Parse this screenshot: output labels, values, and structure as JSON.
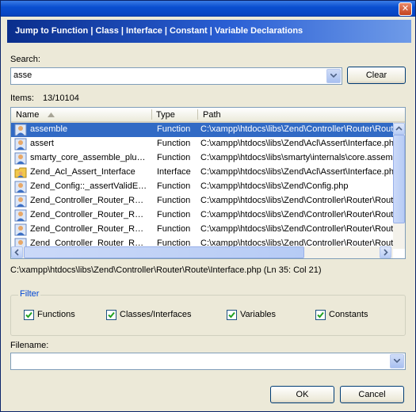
{
  "dialog": {
    "header": "Jump to Function | Class | Interface | Constant | Variable  Declarations",
    "close_glyph": "✕"
  },
  "search": {
    "label": "Search:",
    "value": "asse",
    "clear_label": "Clear"
  },
  "items": {
    "label": "Items:",
    "count": "13/10104"
  },
  "table": {
    "columns": {
      "name": "Name",
      "type": "Type",
      "path": "Path"
    },
    "rows": [
      {
        "name": "assemble",
        "type": "Function",
        "path": "C:\\xampp\\htdocs\\libs\\Zend\\Controller\\Router\\Route\\Interface.php",
        "icon": "function-icon",
        "selected": true
      },
      {
        "name": "assert",
        "type": "Function",
        "path": "C:\\xampp\\htdocs\\libs\\Zend\\Acl\\Assert\\Interface.php",
        "icon": "function-icon"
      },
      {
        "name": "smarty_core_assemble_plu…",
        "type": "Function",
        "path": "C:\\xampp\\htdocs\\libs\\smarty\\internals\\core.assemble_plugin_filepath.php",
        "icon": "function-icon"
      },
      {
        "name": "Zend_Acl_Assert_Interface",
        "type": "Interface",
        "path": "C:\\xampp\\htdocs\\libs\\Zend\\Acl\\Assert\\Interface.php",
        "icon": "interface-icon"
      },
      {
        "name": "Zend_Config::_assertValidE…",
        "type": "Function",
        "path": "C:\\xampp\\htdocs\\libs\\Zend\\Config.php",
        "icon": "function-icon"
      },
      {
        "name": "Zend_Controller_Router_R…",
        "type": "Function",
        "path": "C:\\xampp\\htdocs\\libs\\Zend\\Controller\\Router\\Route\\Hostname.php",
        "icon": "function-icon"
      },
      {
        "name": "Zend_Controller_Router_R…",
        "type": "Function",
        "path": "C:\\xampp\\htdocs\\libs\\Zend\\Controller\\Router\\Route\\Module.php",
        "icon": "function-icon"
      },
      {
        "name": "Zend_Controller_Router_R…",
        "type": "Function",
        "path": "C:\\xampp\\htdocs\\libs\\Zend\\Controller\\Router\\Route\\Regex.php",
        "icon": "function-icon"
      },
      {
        "name": "Zend_Controller_Router_R…",
        "type": "Function",
        "path": "C:\\xampp\\htdocs\\libs\\Zend\\Controller\\Router\\Route\\Static.php",
        "icon": "function-icon"
      }
    ]
  },
  "status": {
    "selected_path": "C:\\xampp\\htdocs\\libs\\Zend\\Controller\\Router\\Route\\Interface.php (Ln 35: Col 21)"
  },
  "filter": {
    "title": "Filter",
    "options": [
      {
        "label": "Functions",
        "checked": true
      },
      {
        "label": "Classes/Interfaces",
        "checked": true
      },
      {
        "label": "Variables",
        "checked": true
      },
      {
        "label": "Constants",
        "checked": true
      }
    ]
  },
  "filename": {
    "label": "Filename:",
    "value": ""
  },
  "footer": {
    "ok_label": "OK",
    "cancel_label": "Cancel"
  },
  "colors": {
    "selection": "#316ac5",
    "banner_start": "#0a2e8c",
    "filter_title": "#0046d5"
  }
}
